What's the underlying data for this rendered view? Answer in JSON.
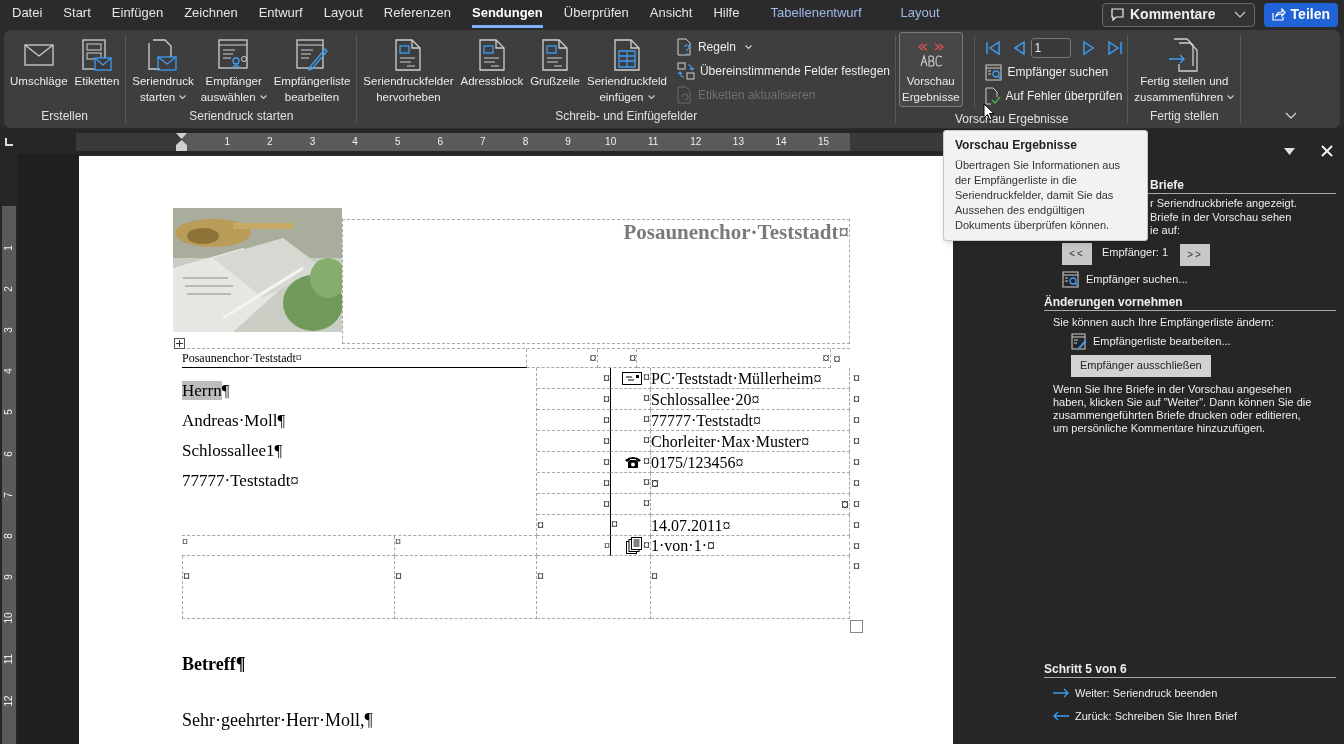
{
  "menu_tabs": [
    {
      "label": "Datei",
      "selected": false,
      "contextual": false
    },
    {
      "label": "Start",
      "selected": false,
      "contextual": false
    },
    {
      "label": "Einfügen",
      "selected": false,
      "contextual": false
    },
    {
      "label": "Zeichnen",
      "selected": false,
      "contextual": false
    },
    {
      "label": "Entwurf",
      "selected": false,
      "contextual": false
    },
    {
      "label": "Layout",
      "selected": false,
      "contextual": false
    },
    {
      "label": "Referenzen",
      "selected": false,
      "contextual": false
    },
    {
      "label": "Sendungen",
      "selected": true,
      "contextual": false
    },
    {
      "label": "Überprüfen",
      "selected": false,
      "contextual": false
    },
    {
      "label": "Ansicht",
      "selected": false,
      "contextual": false
    },
    {
      "label": "Hilfe",
      "selected": false,
      "contextual": false
    },
    {
      "label": "Tabellenentwurf",
      "selected": false,
      "contextual": true
    },
    {
      "label": "Layout",
      "selected": false,
      "contextual": true
    }
  ],
  "comments_button": {
    "label": "Kommentare"
  },
  "share_button": {
    "label": "Teilen"
  },
  "ribbon": {
    "groups": [
      {
        "label": "Erstellen",
        "items": [
          {
            "kind": "large",
            "lines": [
              "Umschläge"
            ],
            "dropdown": false,
            "selected": false
          },
          {
            "kind": "large",
            "lines": [
              "Etiketten"
            ],
            "dropdown": false,
            "selected": false
          }
        ]
      },
      {
        "label": "Seriendruck starten",
        "items": [
          {
            "kind": "large",
            "lines": [
              "Seriendruck",
              "starten"
            ],
            "dropdown": true,
            "selected": false
          },
          {
            "kind": "large",
            "lines": [
              "Empfänger",
              "auswählen"
            ],
            "dropdown": true,
            "selected": false
          },
          {
            "kind": "large",
            "lines": [
              "Empfängerliste",
              "bearbeiten"
            ],
            "dropdown": false,
            "selected": false
          }
        ]
      },
      {
        "label": "Schreib- und Einfügefelder",
        "items": [
          {
            "kind": "large",
            "lines": [
              "Seriendruckfelder",
              "hervorheben"
            ],
            "dropdown": false,
            "selected": false
          },
          {
            "kind": "large",
            "lines": [
              "Adressblock"
            ],
            "dropdown": false,
            "selected": false
          },
          {
            "kind": "large",
            "lines": [
              "Grußzeile"
            ],
            "dropdown": false,
            "selected": false
          },
          {
            "kind": "large",
            "lines": [
              "Seriendruckfeld",
              "einfügen"
            ],
            "dropdown": true,
            "selected": false
          },
          {
            "kind": "stack",
            "entries": [
              {
                "label": "Regeln",
                "dropdown": true,
                "disabled": false
              },
              {
                "label": "Übereinstimmende Felder festlegen",
                "dropdown": false,
                "disabled": false
              },
              {
                "label": "Etiketten aktualisieren",
                "dropdown": false,
                "disabled": true
              }
            ]
          }
        ]
      },
      {
        "label": "Vorschau Ergebnisse",
        "items": [
          {
            "kind": "large",
            "lines": [
              "Vorschau",
              "Ergebnisse"
            ],
            "dropdown": false,
            "selected": true
          },
          {
            "kind": "navigator",
            "record": "1",
            "entries": [
              {
                "label": "Empfänger suchen",
                "dropdown": false,
                "disabled": false
              },
              {
                "label": "Auf Fehler überprüfen",
                "dropdown": false,
                "disabled": false
              }
            ]
          }
        ]
      },
      {
        "label": "Fertig stellen",
        "items": [
          {
            "kind": "large",
            "lines": [
              "Fertig stellen und",
              "zusammenführen"
            ],
            "dropdown": true,
            "selected": false
          }
        ]
      }
    ]
  },
  "ruler": {
    "horizontal": [
      "1",
      "2",
      "3",
      "4",
      "5",
      "6",
      "7",
      "8",
      "9",
      "10",
      "11",
      "12",
      "13",
      "14",
      "15"
    ],
    "vertical": [
      "1",
      "2",
      "3",
      "4",
      "5",
      "6",
      "7",
      "8",
      "9",
      "10",
      "11",
      "12"
    ]
  },
  "document": {
    "letterhead": "Posaunenchor·Teststadt¤",
    "table": {
      "header": {
        "left": "Posaunenchor·Teststadt¤",
        "cells": [
          "¤",
          "¤",
          "¤"
        ],
        "end": "¤"
      },
      "address": [
        {
          "text": "Herrn",
          "end": "¶",
          "highlighted": true
        },
        {
          "text": "Andreas·Moll",
          "end": "¶",
          "highlighted": false
        },
        {
          "text": "Schlossallee1",
          "end": "¶",
          "highlighted": false
        },
        {
          "text": "77777·Teststadt",
          "end": "¤",
          "highlighted": false
        }
      ],
      "rows": [
        {
          "kind": "card",
          "mid": "¤",
          "icon_mark": "¤",
          "text": "PC·Teststadt·Müllerheim¤",
          "end": "¤"
        },
        {
          "kind": "plain",
          "mid": "¤",
          "icon_mark": "¤",
          "text": "Schlossallee·20¤",
          "end": "¤"
        },
        {
          "kind": "plain",
          "mid": "¤",
          "icon_mark": "¤",
          "text": "77777·Teststadt¤",
          "end": "¤"
        },
        {
          "kind": "plain",
          "mid": "¤",
          "icon_mark": "¤",
          "text": "Chorleiter·Max·Muster¤",
          "end": "¤"
        },
        {
          "kind": "phone",
          "mid": "¤",
          "icon_mark": "¤",
          "text": "0175/123456¤",
          "end": "¤"
        },
        {
          "kind": "plain",
          "mid": "¤",
          "icon_mark": "¤",
          "text": "¤",
          "end": "¤"
        },
        {
          "kind": "trailing",
          "mid": "¤",
          "icon_mark": "¤",
          "text": "¤",
          "end": "¤"
        },
        {
          "kind": "leading",
          "mid": "¤",
          "icon_mark": "¤",
          "text": "14.07.2011¤",
          "end": "¤"
        }
      ],
      "footer_row": {
        "cells": [
          "¤",
          "¤",
          "¤"
        ],
        "icon_mark": "¤",
        "text": "1·von·1·¤",
        "end": "¤"
      },
      "bottom_row": {
        "cells": [
          "¤",
          "¤",
          "¤",
          "¤"
        ],
        "end": "¤"
      }
    },
    "paragraphs": [
      {
        "text": "Betreff¶",
        "bold": true
      },
      {
        "text": "Sehr·geehrter·Herr·Moll,¶",
        "bold": false
      }
    ]
  },
  "tooltip": {
    "title": "Vorschau Ergebnisse",
    "lines": [
      "Übertragen Sie Informationen aus",
      "der Empfängerliste in die",
      "Seriendruckfelder, damit Sie das",
      "Aussehen des endgültigen",
      "Dokuments überprüfen können."
    ]
  },
  "panel": {
    "heading": "Briefe",
    "intro_lines": [
      "r Seriendruckbriefe angezeigt.",
      "Briefe in der Vorschau sehen",
      "ie auf:"
    ],
    "prev_button": "<<",
    "recipient": "Empfänger: 1",
    "next_button": ">>",
    "find_link": "Empfänger suchen...",
    "changes_heading": "Änderungen vornehmen",
    "changes_text": "Sie können auch Ihre Empfängerliste ändern:",
    "edit_link": "Empfängerliste bearbeiten...",
    "exclude_button": "Empfänger ausschließen",
    "info_lines": [
      "Wenn Sie Ihre Briefe in der Vorschau angesehen",
      "haben, klicken Sie auf \"Weiter\". Dann können Sie die",
      "zusammengeführten Briefe drucken oder editieren,",
      "um persönliche Kommentare hinzuzufügen."
    ],
    "step": "Schritt 5 von 6",
    "next_step": "Weiter: Seriendruck beenden",
    "prev_step": "Zurück: Schreiben Sie Ihren Brief"
  }
}
